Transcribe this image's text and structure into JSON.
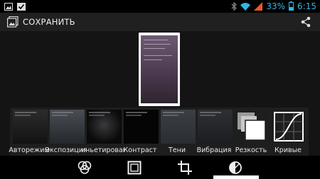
{
  "status_bar": {
    "battery_percent": "33%",
    "time": "6:15",
    "icons": [
      "image-icon",
      "checkmark-icon",
      "bluetooth-icon",
      "wifi-icon",
      "signal-icon",
      "battery-icon"
    ]
  },
  "action_bar": {
    "save_label": "СОХРАНИТЬ",
    "icons": [
      "gallery-icon",
      "share-icon"
    ]
  },
  "filters": [
    {
      "label": "Авторежим"
    },
    {
      "label": "Экспозиция"
    },
    {
      "label": "иньетирован"
    },
    {
      "label": "Контраст"
    },
    {
      "label": "Тени"
    },
    {
      "label": "Вибрация"
    },
    {
      "label": "Резкость"
    },
    {
      "label": "Кривые"
    }
  ],
  "bottom_tools": {
    "icons": [
      "filters-icon",
      "frame-icon",
      "crop-icon",
      "adjust-icon"
    ],
    "selected": "adjust-icon"
  },
  "colors": {
    "accent": "#33b5e5",
    "battery_low": "#e35b2a",
    "background": "#141414"
  }
}
